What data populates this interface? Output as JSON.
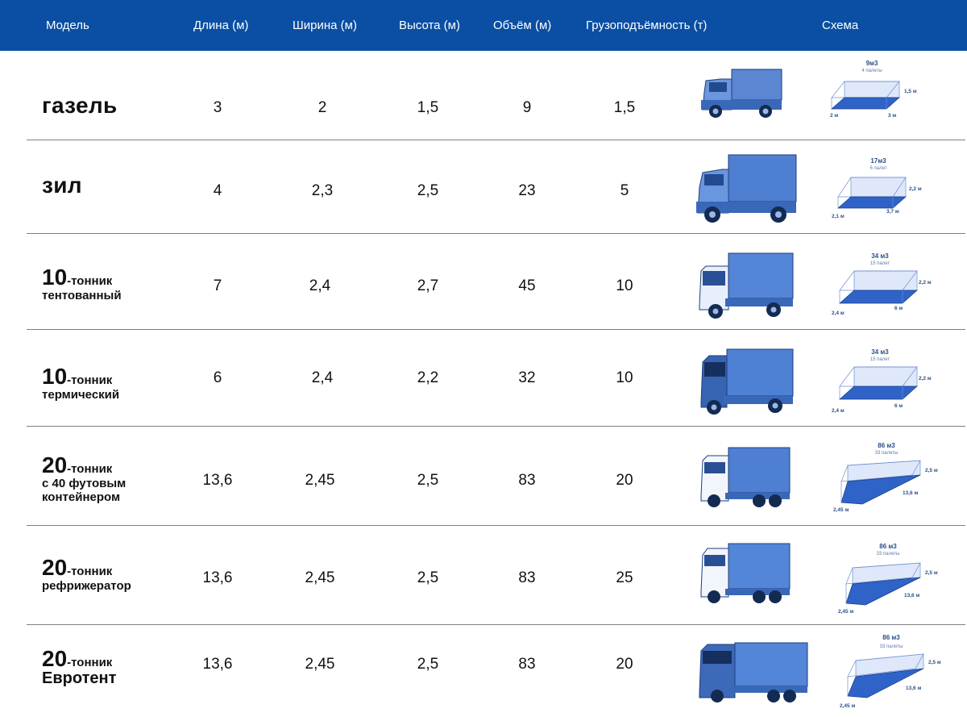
{
  "header": {
    "model": "Модель",
    "length": "Длина (м)",
    "width": "Ширина (м)",
    "height": "Высота (м)",
    "volume": "Объём (м)",
    "capacity": "Грузоподъёмность (т)",
    "scheme": "Схема"
  },
  "colors": {
    "header_bg": "#0a4fa3",
    "truck_blue": "#3d6fc4",
    "scheme_floor": "#2f63c8"
  },
  "rows": [
    {
      "name": "газель",
      "length": "3",
      "width": "2",
      "height": "1,5",
      "volume": "9",
      "capacity": "1,5",
      "scheme": {
        "title": "9м3",
        "pallets": "4 палеты",
        "dim_h": "1,5 м",
        "dim_w": "2 м",
        "dim_l": "3 м"
      }
    },
    {
      "name": "зил",
      "length": "4",
      "width": "2,3",
      "height": "2,5",
      "volume": "23",
      "capacity": "5",
      "scheme": {
        "title": "17м3",
        "pallets": "6 палет",
        "dim_h": "2,2 м",
        "dim_w": "2,1 м",
        "dim_l": "3,7 м"
      }
    },
    {
      "num": "10",
      "suffix": "-тонник",
      "sub": "тентованный",
      "length": "7",
      "width": "2,4",
      "height": "2,7",
      "volume": "45",
      "capacity": "10",
      "scheme": {
        "title": "34 м3",
        "pallets": "15 палет",
        "dim_h": "2,2 м",
        "dim_w": "2,4 м",
        "dim_l": "6 м"
      }
    },
    {
      "num": "10",
      "suffix": "-тонник",
      "sub": "термический",
      "length": "6",
      "width": "2,4",
      "height": "2,2",
      "volume": "32",
      "capacity": "10",
      "scheme": {
        "title": "34 м3",
        "pallets": "15 палет",
        "dim_h": "2,2 м",
        "dim_w": "2,4 м",
        "dim_l": "6 м"
      }
    },
    {
      "num": "20",
      "suffix": "-тонник",
      "sub": "с 40 футовым",
      "sub2": "контейнером",
      "length": "13,6",
      "width": "2,45",
      "height": "2,5",
      "volume": "83",
      "capacity": "20",
      "scheme": {
        "title": "86 м3",
        "pallets": "33 палеты",
        "dim_h": "2,5 м",
        "dim_w": "2,45 м",
        "dim_l": "13,6 м"
      }
    },
    {
      "num": "20",
      "suffix": "-тонник",
      "sub": "рефрижератор",
      "length": "13,6",
      "width": "2,45",
      "height": "2,5",
      "volume": "83",
      "capacity": "25",
      "scheme": {
        "title": "86 м3",
        "pallets": "33 палеты",
        "dim_h": "2,5 м",
        "dim_w": "2,45 м",
        "dim_l": "13,6 м"
      }
    },
    {
      "num": "20",
      "suffix": "-тонник",
      "sub": "Евротент",
      "length": "13,6",
      "width": "2,45",
      "height": "2,5",
      "volume": "83",
      "capacity": "20",
      "scheme": {
        "title": "86 м3",
        "pallets": "33 палеты",
        "dim_h": "2,5 м",
        "dim_w": "2,45 м",
        "dim_l": "13,6 м"
      }
    }
  ]
}
